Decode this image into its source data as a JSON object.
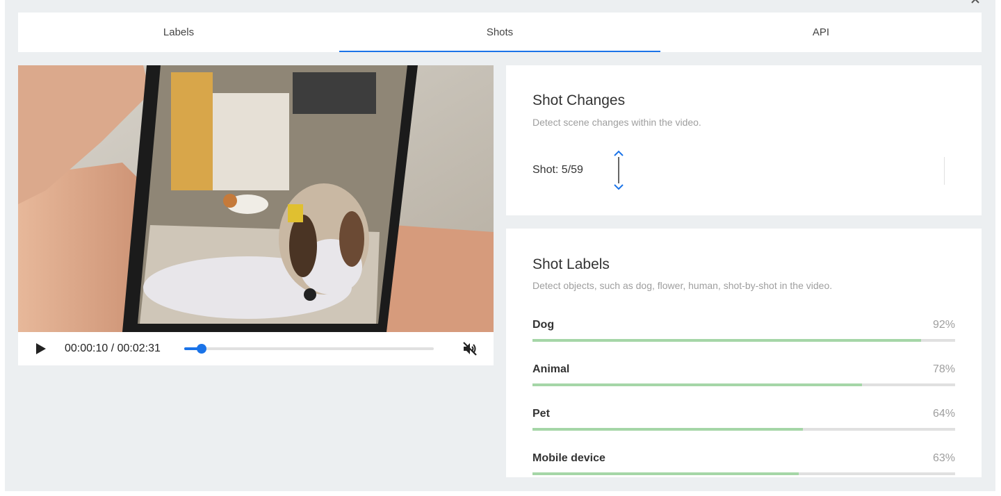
{
  "tabs": [
    {
      "label": "Labels",
      "active": false
    },
    {
      "label": "Shots",
      "active": true
    },
    {
      "label": "API",
      "active": false
    }
  ],
  "video": {
    "time_display": "00:00:10 / 00:02:31",
    "progress": 0.07,
    "muted": true,
    "play_icon": "play-icon",
    "mute_icon": "volume-off-icon"
  },
  "shot_changes": {
    "title": "Shot Changes",
    "subtitle": "Detect scene changes within the video.",
    "counter": "Shot: 5/59"
  },
  "shot_labels": {
    "title": "Shot Labels",
    "subtitle": "Detect objects, such as dog, flower, human, shot-by-shot in the video.",
    "items": [
      {
        "name": "Dog",
        "percent_label": "92%",
        "value": 0.92
      },
      {
        "name": "Animal",
        "percent_label": "78%",
        "value": 0.78
      },
      {
        "name": "Pet",
        "percent_label": "64%",
        "value": 0.64
      },
      {
        "name": "Mobile device",
        "percent_label": "63%",
        "value": 0.63
      }
    ]
  },
  "colors": {
    "accent": "#1a73e8",
    "bar": "#a5d6a7",
    "background": "#eceff1"
  }
}
